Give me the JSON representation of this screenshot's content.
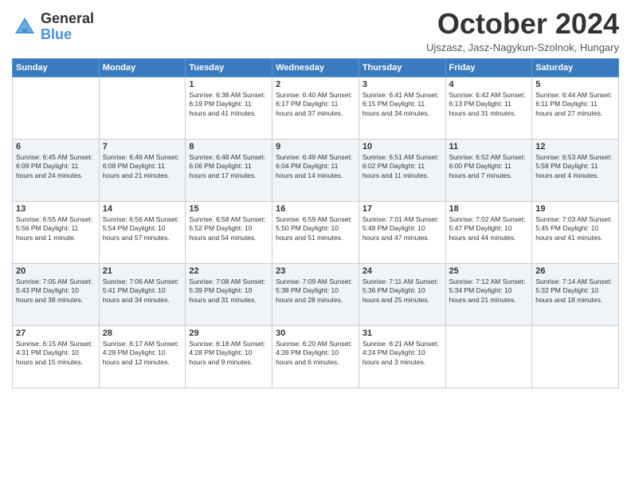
{
  "header": {
    "logo_line1": "General",
    "logo_line2": "Blue",
    "month": "October 2024",
    "location": "Ujszasz, Jasz-Nagykun-Szolnok, Hungary"
  },
  "weekdays": [
    "Sunday",
    "Monday",
    "Tuesday",
    "Wednesday",
    "Thursday",
    "Friday",
    "Saturday"
  ],
  "weeks": [
    [
      {
        "day": "",
        "info": ""
      },
      {
        "day": "",
        "info": ""
      },
      {
        "day": "1",
        "info": "Sunrise: 6:38 AM\nSunset: 6:19 PM\nDaylight: 11 hours and 41 minutes."
      },
      {
        "day": "2",
        "info": "Sunrise: 6:40 AM\nSunset: 6:17 PM\nDaylight: 11 hours and 37 minutes."
      },
      {
        "day": "3",
        "info": "Sunrise: 6:41 AM\nSunset: 6:15 PM\nDaylight: 11 hours and 34 minutes."
      },
      {
        "day": "4",
        "info": "Sunrise: 6:42 AM\nSunset: 6:13 PM\nDaylight: 11 hours and 31 minutes."
      },
      {
        "day": "5",
        "info": "Sunrise: 6:44 AM\nSunset: 6:11 PM\nDaylight: 11 hours and 27 minutes."
      }
    ],
    [
      {
        "day": "6",
        "info": "Sunrise: 6:45 AM\nSunset: 6:09 PM\nDaylight: 11 hours and 24 minutes."
      },
      {
        "day": "7",
        "info": "Sunrise: 6:46 AM\nSunset: 6:08 PM\nDaylight: 11 hours and 21 minutes."
      },
      {
        "day": "8",
        "info": "Sunrise: 6:48 AM\nSunset: 6:06 PM\nDaylight: 11 hours and 17 minutes."
      },
      {
        "day": "9",
        "info": "Sunrise: 6:49 AM\nSunset: 6:04 PM\nDaylight: 11 hours and 14 minutes."
      },
      {
        "day": "10",
        "info": "Sunrise: 6:51 AM\nSunset: 6:02 PM\nDaylight: 11 hours and 11 minutes."
      },
      {
        "day": "11",
        "info": "Sunrise: 6:52 AM\nSunset: 6:00 PM\nDaylight: 11 hours and 7 minutes."
      },
      {
        "day": "12",
        "info": "Sunrise: 6:53 AM\nSunset: 5:58 PM\nDaylight: 11 hours and 4 minutes."
      }
    ],
    [
      {
        "day": "13",
        "info": "Sunrise: 6:55 AM\nSunset: 5:56 PM\nDaylight: 11 hours and 1 minute."
      },
      {
        "day": "14",
        "info": "Sunrise: 6:56 AM\nSunset: 5:54 PM\nDaylight: 10 hours and 57 minutes."
      },
      {
        "day": "15",
        "info": "Sunrise: 6:58 AM\nSunset: 5:52 PM\nDaylight: 10 hours and 54 minutes."
      },
      {
        "day": "16",
        "info": "Sunrise: 6:59 AM\nSunset: 5:50 PM\nDaylight: 10 hours and 51 minutes."
      },
      {
        "day": "17",
        "info": "Sunrise: 7:01 AM\nSunset: 5:48 PM\nDaylight: 10 hours and 47 minutes."
      },
      {
        "day": "18",
        "info": "Sunrise: 7:02 AM\nSunset: 5:47 PM\nDaylight: 10 hours and 44 minutes."
      },
      {
        "day": "19",
        "info": "Sunrise: 7:03 AM\nSunset: 5:45 PM\nDaylight: 10 hours and 41 minutes."
      }
    ],
    [
      {
        "day": "20",
        "info": "Sunrise: 7:05 AM\nSunset: 5:43 PM\nDaylight: 10 hours and 38 minutes."
      },
      {
        "day": "21",
        "info": "Sunrise: 7:06 AM\nSunset: 5:41 PM\nDaylight: 10 hours and 34 minutes."
      },
      {
        "day": "22",
        "info": "Sunrise: 7:08 AM\nSunset: 5:39 PM\nDaylight: 10 hours and 31 minutes."
      },
      {
        "day": "23",
        "info": "Sunrise: 7:09 AM\nSunset: 5:38 PM\nDaylight: 10 hours and 28 minutes."
      },
      {
        "day": "24",
        "info": "Sunrise: 7:11 AM\nSunset: 5:36 PM\nDaylight: 10 hours and 25 minutes."
      },
      {
        "day": "25",
        "info": "Sunrise: 7:12 AM\nSunset: 5:34 PM\nDaylight: 10 hours and 21 minutes."
      },
      {
        "day": "26",
        "info": "Sunrise: 7:14 AM\nSunset: 5:32 PM\nDaylight: 10 hours and 18 minutes."
      }
    ],
    [
      {
        "day": "27",
        "info": "Sunrise: 6:15 AM\nSunset: 4:31 PM\nDaylight: 10 hours and 15 minutes."
      },
      {
        "day": "28",
        "info": "Sunrise: 6:17 AM\nSunset: 4:29 PM\nDaylight: 10 hours and 12 minutes."
      },
      {
        "day": "29",
        "info": "Sunrise: 6:18 AM\nSunset: 4:28 PM\nDaylight: 10 hours and 9 minutes."
      },
      {
        "day": "30",
        "info": "Sunrise: 6:20 AM\nSunset: 4:26 PM\nDaylight: 10 hours and 6 minutes."
      },
      {
        "day": "31",
        "info": "Sunrise: 6:21 AM\nSunset: 4:24 PM\nDaylight: 10 hours and 3 minutes."
      },
      {
        "day": "",
        "info": ""
      },
      {
        "day": "",
        "info": ""
      }
    ]
  ]
}
